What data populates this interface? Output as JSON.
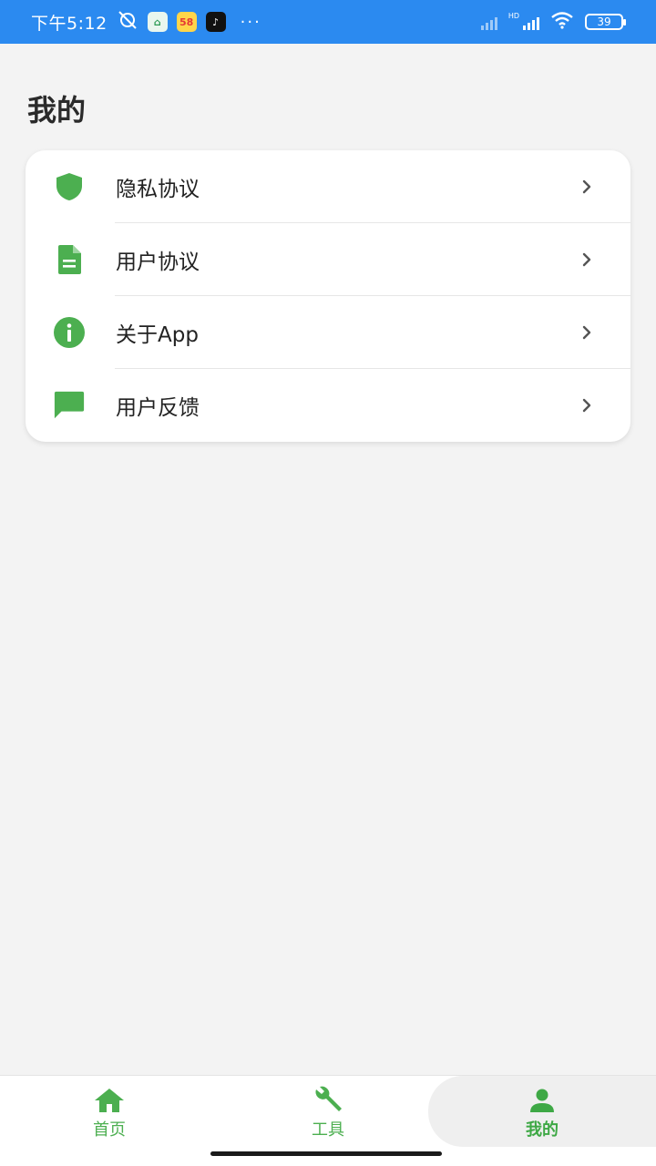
{
  "status_bar": {
    "time": "下午5:12",
    "app1": "⌂",
    "app2": "58",
    "app3": "♪",
    "more": "···",
    "hd": "HD",
    "battery": "39"
  },
  "page": {
    "title": "我的"
  },
  "menu": [
    {
      "label": "隐私协议",
      "icon": "shield-icon"
    },
    {
      "label": "用户协议",
      "icon": "document-icon"
    },
    {
      "label": "关于App",
      "icon": "info-icon"
    },
    {
      "label": "用户反馈",
      "icon": "feedback-icon"
    }
  ],
  "bottom_nav": {
    "home": "首页",
    "tools": "工具",
    "mine": "我的",
    "active": "mine"
  },
  "colors": {
    "accent": "#4caf50",
    "status_bar": "#2b8af0"
  }
}
